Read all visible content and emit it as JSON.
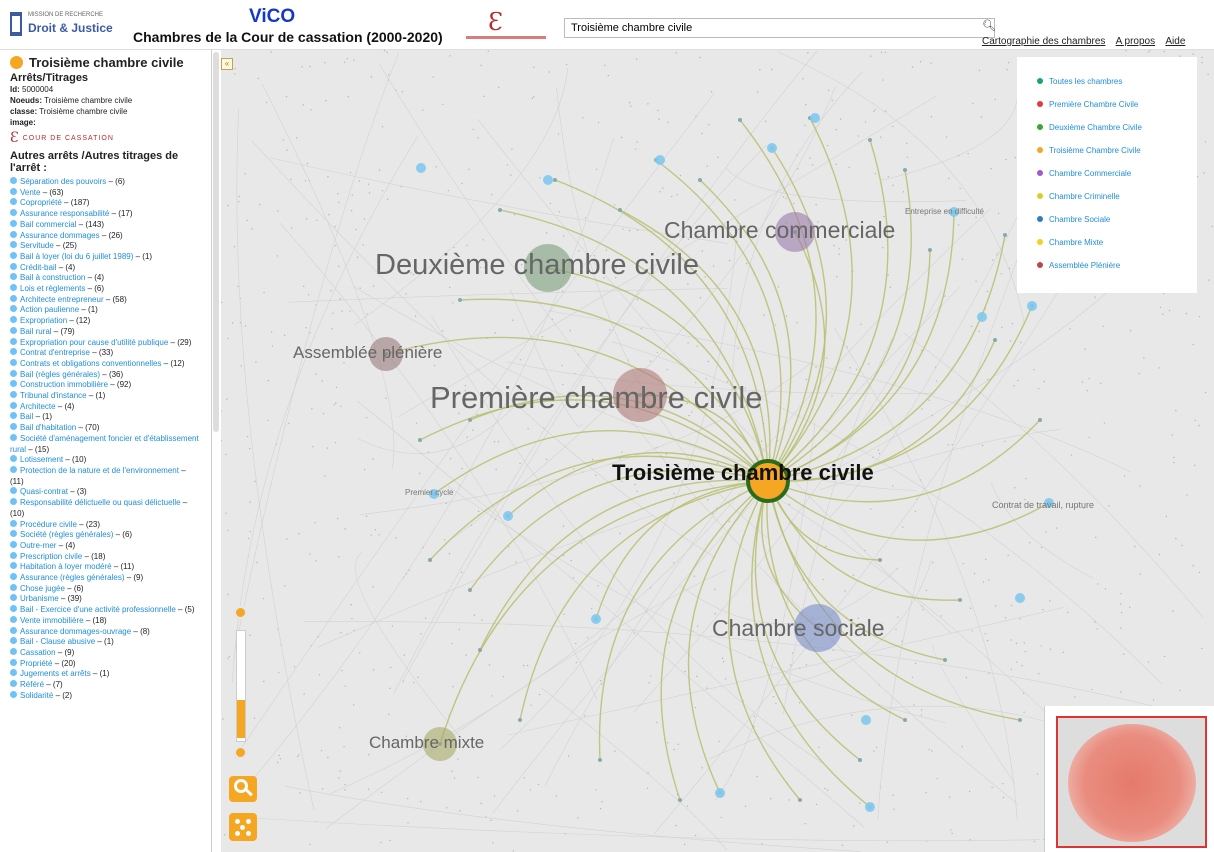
{
  "header": {
    "institution_line1": "MISSION DE RECHERCHE",
    "institution_line2": "Droit & Justice",
    "app_name": "ViCO",
    "app_subtitle": "Chambres de la Cour de cassation (2000-2020)",
    "search_value": "Troisième chambre civile",
    "links": [
      "Cartographie des chambres",
      "A propos",
      "Aide"
    ]
  },
  "sidebar": {
    "title": "Troisième chambre civile",
    "subtitle": "Arrêts/Titrages",
    "id_label": "Id:",
    "id_value": "5000004",
    "noeud_label": "Noeuds:",
    "noeud_value": "Troisième chambre civile",
    "classe_label": "classe:",
    "classe_value": "Troisième chambre civile",
    "image_label": "image:",
    "cc_logo_text": "COUR DE CASSATION",
    "list_heading": "Autres arrêts /Autres titrages de l'arrêt :",
    "items": [
      {
        "label": "Séparation des pouvoirs",
        "count": "(6)"
      },
      {
        "label": "Vente",
        "count": "(63)"
      },
      {
        "label": "Copropriété",
        "count": "(187)"
      },
      {
        "label": "Assurance responsabilité",
        "count": "(17)"
      },
      {
        "label": "Bail commercial",
        "count": "(143)"
      },
      {
        "label": "Assurance dommages",
        "count": "(26)"
      },
      {
        "label": "Servitude",
        "count": "(25)"
      },
      {
        "label": "Bail à loyer (loi du 6 juillet 1989)",
        "count": "(1)"
      },
      {
        "label": "Crédit-bail",
        "count": "(4)"
      },
      {
        "label": "Bail à construction",
        "count": "(4)"
      },
      {
        "label": "Lois et règlements",
        "count": "(6)"
      },
      {
        "label": "Architecte entrepreneur",
        "count": "(58)"
      },
      {
        "label": "Action paulienne",
        "count": "(1)"
      },
      {
        "label": "Expropriation",
        "count": "(12)"
      },
      {
        "label": "Bail rural",
        "count": "(79)"
      },
      {
        "label": "Expropriation pour cause d'utilité publique",
        "count": "(29)"
      },
      {
        "label": "Contrat d'entreprise",
        "count": "(33)"
      },
      {
        "label": "Contrats et obligations conventionnelles",
        "count": "(12)"
      },
      {
        "label": "Bail (règles générales)",
        "count": "(36)"
      },
      {
        "label": "Construction immobilière",
        "count": "(92)"
      },
      {
        "label": "Tribunal d'instance",
        "count": "(1)"
      },
      {
        "label": "Architecte",
        "count": "(4)"
      },
      {
        "label": "Bail",
        "count": "(1)"
      },
      {
        "label": "Bail d'habitation",
        "count": "(70)"
      },
      {
        "label": "Société d'aménagement foncier et d'établissement rural",
        "count": "(15)"
      },
      {
        "label": "Lotissement",
        "count": "(10)"
      },
      {
        "label": "Protection de la nature et de l'environnement",
        "count": "(11)"
      },
      {
        "label": "Quasi-contrat",
        "count": "(3)"
      },
      {
        "label": "Responsabilité délictuelle ou quasi délictuelle",
        "count": "(10)"
      },
      {
        "label": "Procédure civile",
        "count": "(23)"
      },
      {
        "label": "Société (règles générales)",
        "count": "(6)"
      },
      {
        "label": "Outre-mer",
        "count": "(4)"
      },
      {
        "label": "Prescription civile",
        "count": "(18)"
      },
      {
        "label": "Habitation à loyer modéré",
        "count": "(11)"
      },
      {
        "label": "Assurance (règles générales)",
        "count": "(9)"
      },
      {
        "label": "Chose jugée",
        "count": "(6)"
      },
      {
        "label": "Urbanisme",
        "count": "(39)"
      },
      {
        "label": "Bail - Exercice d'une activité professionnelle",
        "count": "(5)"
      },
      {
        "label": "Vente immobilière",
        "count": "(18)"
      },
      {
        "label": "Assurance dommages-ouvrage",
        "count": "(8)"
      },
      {
        "label": "Bail - Clause abusive",
        "count": "(1)"
      },
      {
        "label": "Cassation",
        "count": "(9)"
      },
      {
        "label": "Propriété",
        "count": "(20)"
      },
      {
        "label": "Jugements et arrêts",
        "count": "(1)"
      },
      {
        "label": "Référé",
        "count": "(7)"
      },
      {
        "label": "Solidarité",
        "count": "(2)"
      }
    ]
  },
  "graph": {
    "nodes": {
      "troisieme": "Troisième chambre civile",
      "premiere": "Première chambre civile",
      "deuxieme": "Deuxième chambre civile",
      "commerciale": "Chambre commerciale",
      "sociale": "Chambre sociale",
      "mixte": "Chambre mixte",
      "pleniere": "Assemblée plénière"
    },
    "small_labels": {
      "premier_cycle": "Premier cycle",
      "contrat_travail": "Contrat de travail, rupture",
      "entreprise": "Entreprise en difficulté"
    }
  },
  "legend": {
    "items": [
      {
        "label": "Toutes les chambres",
        "color": "#1aa37a"
      },
      {
        "label": "Première Chambre Civile",
        "color": "#e8383b"
      },
      {
        "label": "Deuxième Chambre Civile",
        "color": "#3aa63a"
      },
      {
        "label": "Troisième Chambre Civile",
        "color": "#f5a623"
      },
      {
        "label": "Chambre Commerciale",
        "color": "#a258c9"
      },
      {
        "label": "Chambre Criminelle",
        "color": "#d2d22a"
      },
      {
        "label": "Chambre Sociale",
        "color": "#2c7fc0"
      },
      {
        "label": "Chambre Mixte",
        "color": "#f2d21e"
      },
      {
        "label": "Assemblée Plénière",
        "color": "#b84848"
      }
    ]
  },
  "colors": {
    "accent": "#f5a623",
    "link": "#1f8ed8",
    "app_name": "#1539c6"
  }
}
